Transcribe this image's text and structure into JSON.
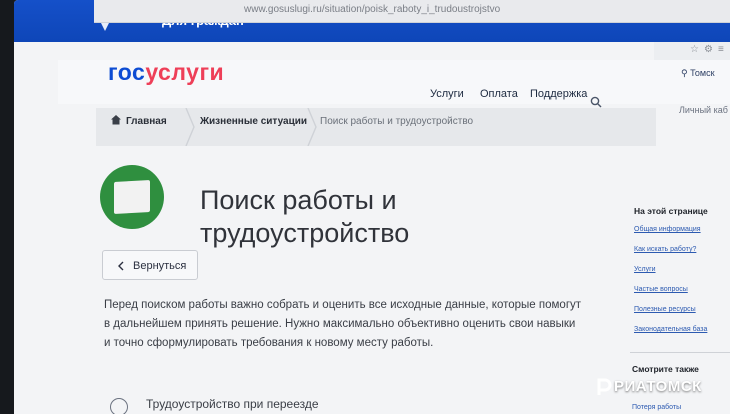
{
  "browser": {
    "url": "www.gosuslugi.ru/situation/poisk_raboty_i_trudoustrojstvo"
  },
  "topnav": {
    "audience_label": "Для граждан"
  },
  "header": {
    "logo_part1": "гос",
    "logo_part2": "услуги",
    "menu": [
      "Услуги",
      "Оплата",
      "Поддержка"
    ],
    "city": "Томск",
    "account": "Личный каб"
  },
  "breadcrumb": {
    "items": [
      "Главная",
      "Жизненные ситуации",
      "Поиск работы и трудоустройство"
    ]
  },
  "page": {
    "title_line1": "Поиск работы и",
    "title_line2": "трудоустройство",
    "back_label": "Вернуться",
    "intro": "Перед поиском работы важно собрать и оценить все исходные данные, которые помогут в дальнейшем принять решение. Нужно максимально объективно оценить свои навыки и точно сформулировать требования к новому месту работы.",
    "first_item": "Трудоустройство при переезде"
  },
  "sidebar": {
    "title": "На этой странице",
    "links": [
      "Общая информация",
      "Как искать работу?",
      "Услуги",
      "Частые вопросы",
      "Полезные ресурсы",
      "Законодательная база"
    ],
    "see_also_title": "Смотрите также",
    "see_also_first": "Потеря работы"
  },
  "watermark": {
    "text": "РИАТОМСК"
  },
  "colors": {
    "nav_blue": "#0d4cd3",
    "logo_red": "#ee3f58",
    "icon_green": "#2f8f3f"
  }
}
